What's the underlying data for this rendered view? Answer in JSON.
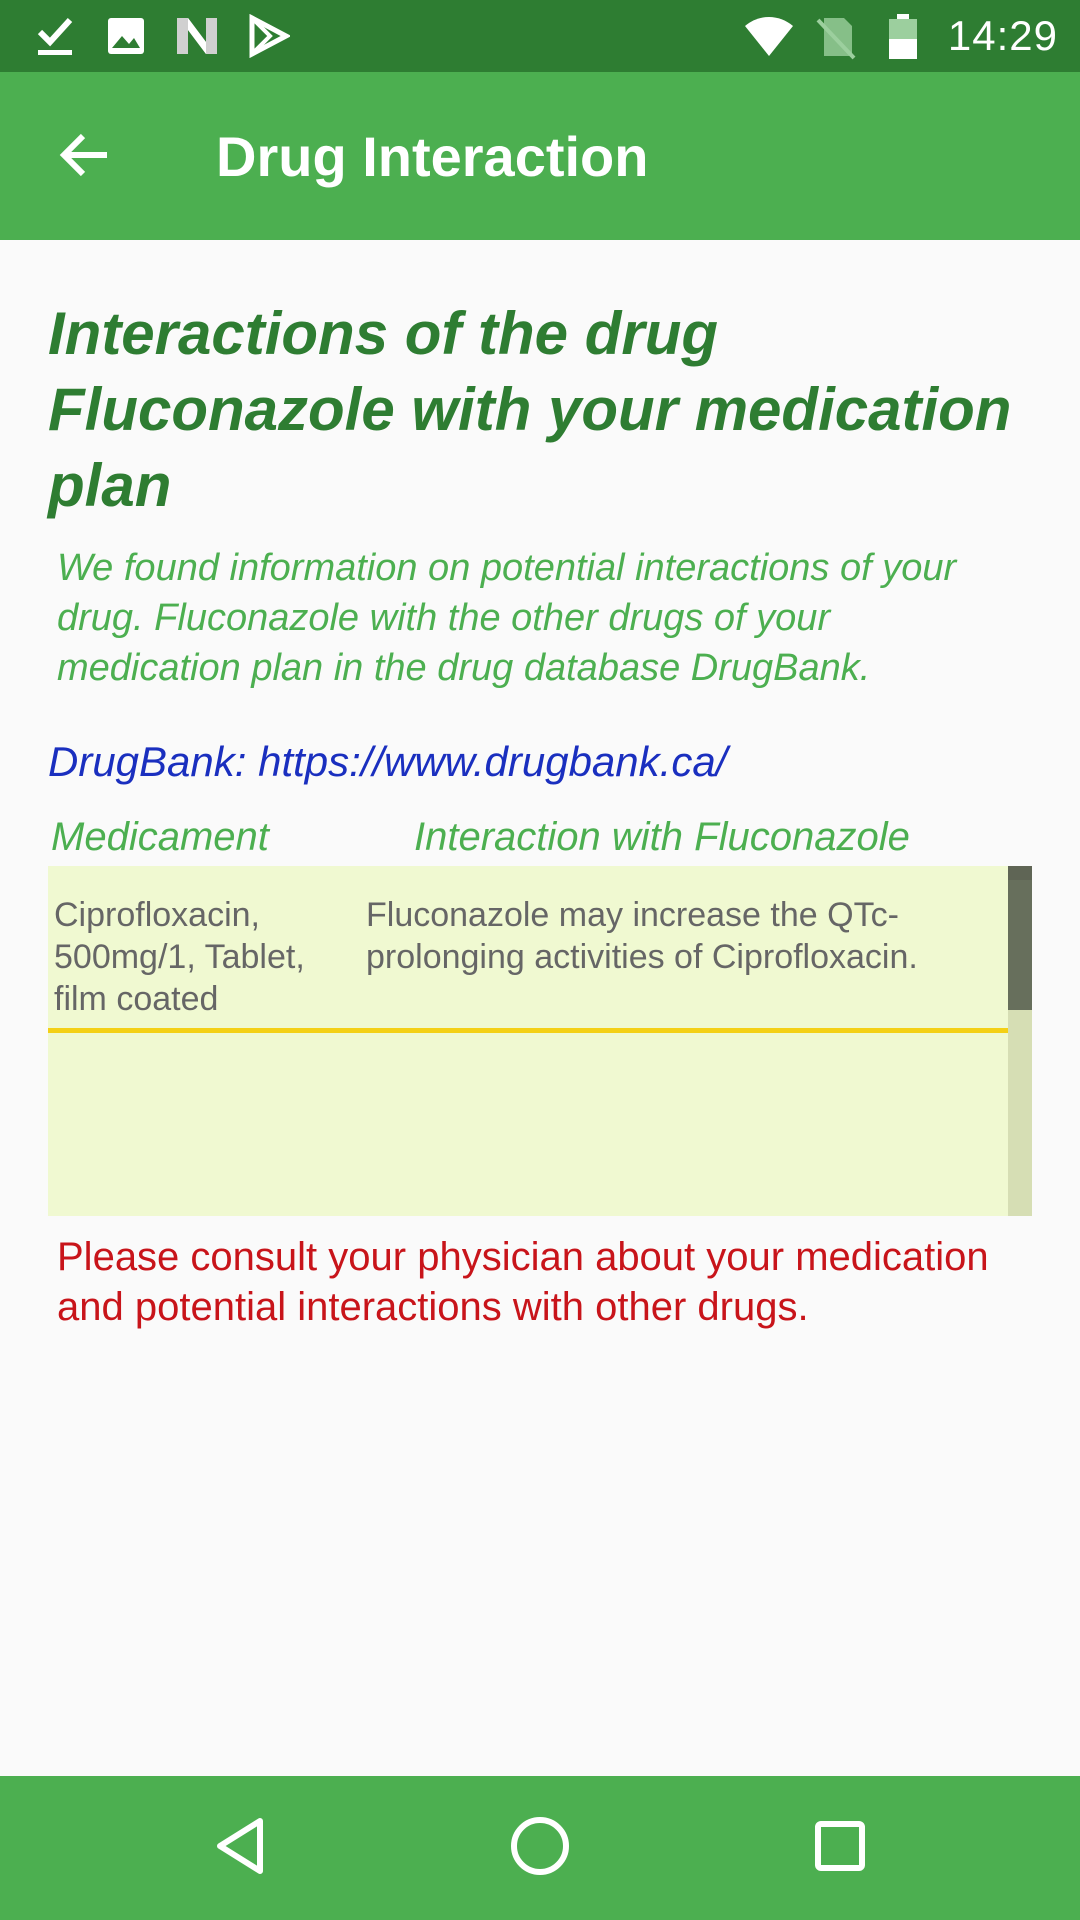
{
  "status_bar": {
    "time": "14:29",
    "left_icons": [
      "download-done-icon",
      "image-icon",
      "n-logo-icon",
      "play-store-icon"
    ],
    "right_icons": [
      "wifi-icon",
      "no-sim-icon",
      "battery-icon"
    ],
    "color": "#2e7d32"
  },
  "app_bar": {
    "title": "Drug Interaction",
    "back_icon": "arrow-back-icon",
    "color": "#4caf50"
  },
  "content": {
    "heading": "Interactions of the drug Fluconazole with your medication plan",
    "intro": "We found information on potential interactions of your drug. Fluconazole with the other drugs of your medication plan in the drug database DrugBank.",
    "source": "DrugBank: https://www.drugbank.ca/",
    "table": {
      "headers": [
        "Medicament",
        "Interaction with Fluconazole"
      ],
      "rows": [
        {
          "medicament": "Ciprofloxacin, 500mg/1, Tablet, film coated",
          "interaction": "Fluconazole may increase the QTc-prolonging activities of Ciprofloxacin."
        }
      ],
      "background": "#f0f9d1",
      "separator_color": "#f4d016"
    },
    "warning": "Please consult your physician about your medication and potential interactions with other drugs.",
    "warning_color": "#c8141a"
  },
  "nav_bar": {
    "buttons": [
      "back-triangle-icon",
      "home-circle-icon",
      "recents-square-icon"
    ],
    "color": "#4caf50"
  }
}
